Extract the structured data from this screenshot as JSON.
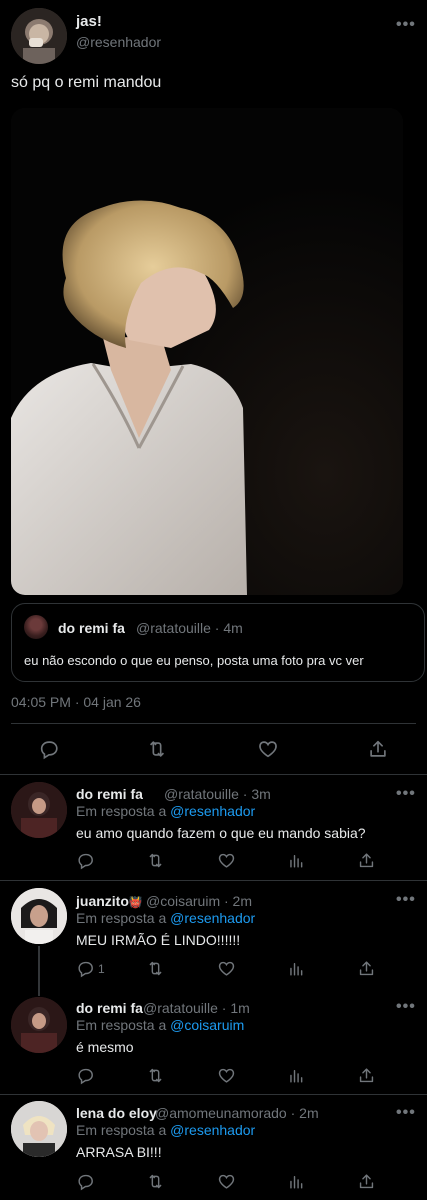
{
  "main_tweet": {
    "display_name": "jas!",
    "handle": "@resenhador",
    "text": "só pq o remi mandou",
    "timestamp": "04:05 PM · 04 jan 26",
    "quoted": {
      "display_name": "do remi fa",
      "meta": "@ratatouille · 4m",
      "text": "eu não escondo o que eu penso, posta uma foto pra vc ver"
    }
  },
  "replies": [
    {
      "display_name": "do remi fa",
      "meta": "@ratatouille · 3m",
      "reply_prefix": "Em resposta a",
      "reply_target": "@resenhador",
      "text": "eu amo quando fazem o que eu mando sabia?",
      "reply_count": ""
    },
    {
      "display_name": "juanzito",
      "emoji": "👹",
      "meta": "@coisaruim · 2m",
      "reply_prefix": "Em resposta a",
      "reply_target": "@resenhador",
      "text": "MEU IRMÃO É LINDO!!!!!!",
      "reply_count": "1"
    },
    {
      "display_name": "do remi fa",
      "meta": "@ratatouille · 1m",
      "reply_prefix": "Em resposta a",
      "reply_target": "@coisaruim",
      "text": "é mesmo",
      "reply_count": ""
    },
    {
      "display_name": "lena do eloy",
      "meta": "@amomeunamorado · 2m",
      "reply_prefix": "Em resposta a",
      "reply_target": "@resenhador",
      "text": "ARRASA BI!!!",
      "reply_count": ""
    }
  ],
  "more_menu": "•••",
  "icons": [
    "reply-icon",
    "retweet-icon",
    "like-icon",
    "share-icon",
    "views-icon",
    "more-icon"
  ],
  "colors": {
    "background": "#000000",
    "text": "#e7e9ea",
    "muted": "#71767b",
    "link": "#1d9bf0",
    "border": "#2f3336"
  }
}
